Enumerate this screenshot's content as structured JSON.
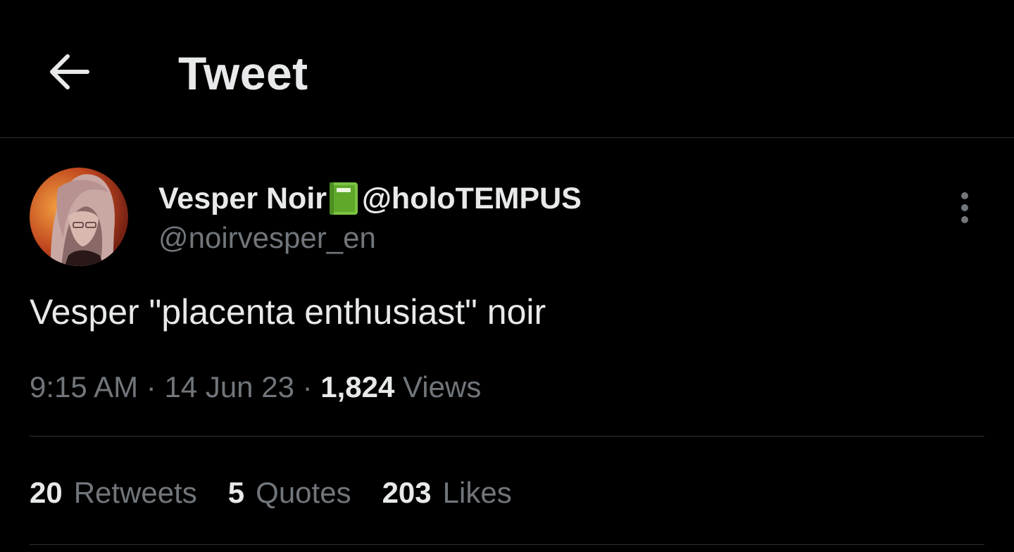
{
  "header": {
    "title": "Tweet",
    "back_icon": "arrow-left-icon"
  },
  "author": {
    "display_name": "Vesper Noir",
    "emoji_icon": "green-book-emoji-icon",
    "display_name_suffix": "@holoTEMPUS",
    "handle": "@noirvesper_en",
    "more_icon": "vertical-ellipsis-icon"
  },
  "tweet": {
    "text": "Vesper \"placenta enthusiast\" noir"
  },
  "meta": {
    "time": "9:15 AM",
    "separator": " · ",
    "date": "14 Jun 23",
    "views_count": "1,824",
    "views_label": " Views"
  },
  "stats": [
    {
      "count": "20",
      "label": "Retweets"
    },
    {
      "count": "5",
      "label": "Quotes"
    },
    {
      "count": "203",
      "label": "Likes"
    }
  ],
  "colors": {
    "background": "#000000",
    "primary_text": "#e7e9ea",
    "secondary_text": "#71767b",
    "divider": "#2f3336"
  }
}
